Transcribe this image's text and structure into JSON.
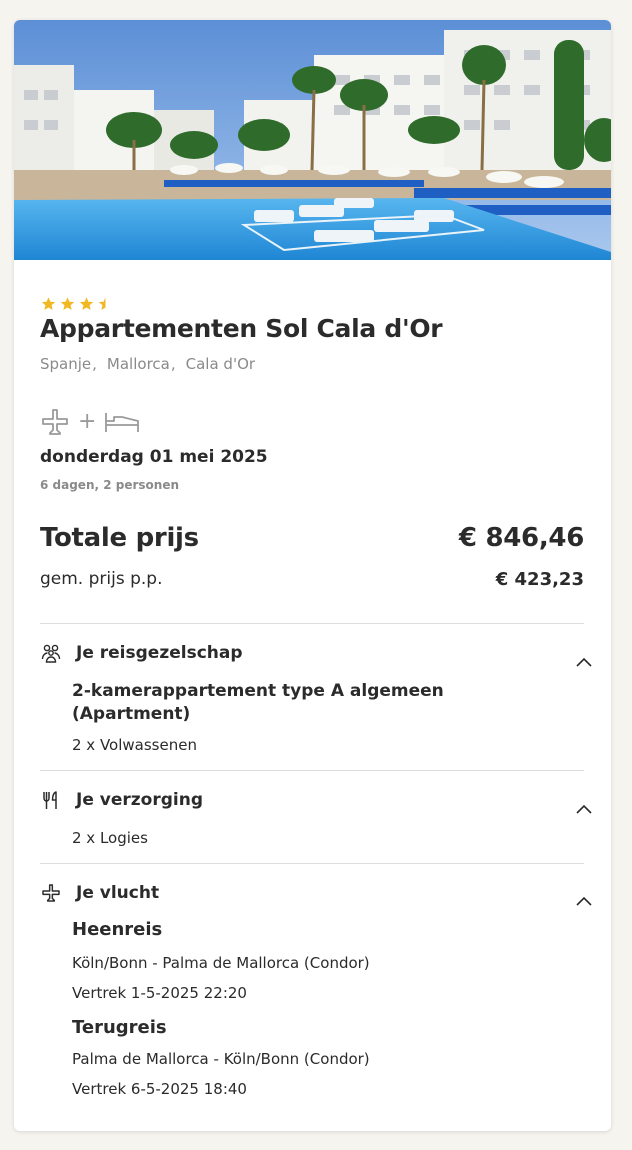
{
  "hotel": {
    "rating": 3.5,
    "name": "Appartementen Sol Cala d'Or",
    "location": [
      "Spanje",
      "Mallorca",
      "Cala d'Or"
    ]
  },
  "trip": {
    "transport_icons": [
      "plane-icon",
      "bed-icon"
    ],
    "plus": "+",
    "date": "donderdag 01 mei 2025",
    "duration": "6 dagen, 2 personen"
  },
  "price": {
    "total_label": "Totale prijs",
    "total_value": "€ 846,46",
    "pp_label": "gem. prijs p.p.",
    "pp_value": "€ 423,23"
  },
  "sections": {
    "company": {
      "icon": "group-icon",
      "title": "Je reisgezelschap",
      "room_line1": "2-kamerappartement type A algemeen",
      "room_line2": "(Apartment)",
      "travellers": "2 x Volwassenen"
    },
    "board": {
      "icon": "cutlery-icon",
      "title": "Je verzorging",
      "value": "2 x Logies"
    },
    "flight": {
      "icon": "plane-icon",
      "title": "Je vlucht",
      "outbound_title": "Heenreis",
      "outbound_route": "Köln/Bonn - Palma de Mallorca (Condor)",
      "outbound_departure": "Vertrek 1-5-2025 22:20",
      "return_title": "Terugreis",
      "return_route": "Palma de Mallorca - Köln/Bonn (Condor)",
      "return_departure": "Vertrek 6-5-2025 18:40"
    }
  },
  "colors": {
    "star": "#f2b823",
    "text": "#2b2b2b",
    "muted": "#8a8a8a",
    "divider": "#dedede",
    "pool": "#2a8fd8",
    "loungers": "#1f5fc4"
  }
}
